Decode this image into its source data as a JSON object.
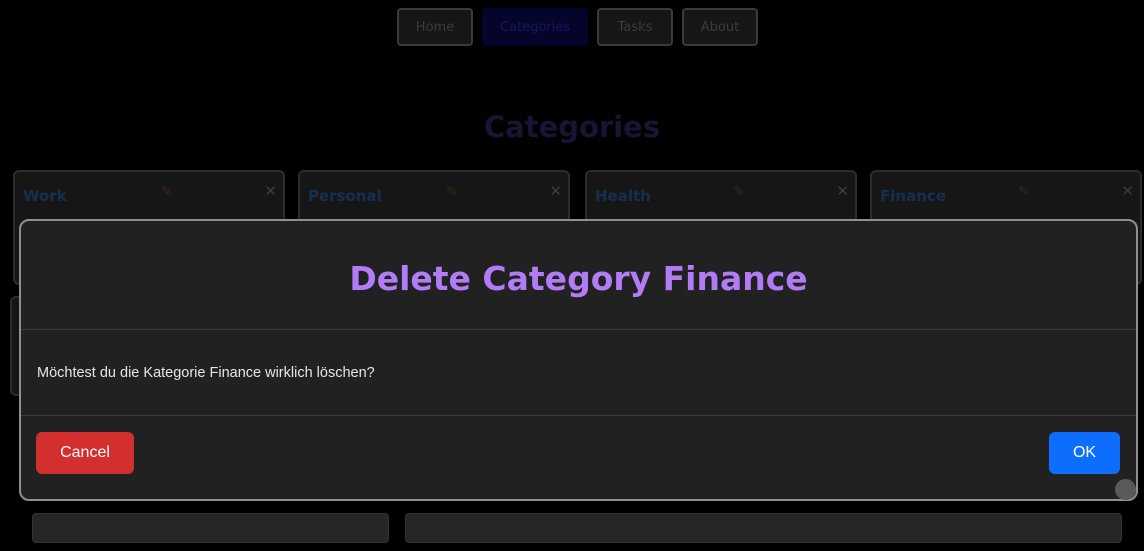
{
  "nav": {
    "tabs": [
      {
        "label": "Home"
      },
      {
        "label": "Categories",
        "active": true
      },
      {
        "label": "Tasks"
      },
      {
        "label": "About"
      }
    ]
  },
  "page": {
    "title": "Categories"
  },
  "categories": [
    {
      "name": "Work",
      "edit_icon": "pencil-icon",
      "close_icon": "close-icon"
    },
    {
      "name": "Personal",
      "edit_icon": "pencil-icon",
      "close_icon": "close-icon"
    },
    {
      "name": "Health",
      "edit_icon": "pencil-icon",
      "close_icon": "close-icon"
    },
    {
      "name": "Finance",
      "edit_icon": "pencil-icon",
      "close_icon": "close-icon"
    }
  ],
  "dialog": {
    "title": "Delete Category Finance",
    "message": "Möchtest du die Kategorie Finance wirklich löschen?",
    "cancel_label": "Cancel",
    "ok_label": "OK"
  },
  "colors": {
    "title": "#b27cf6",
    "cancel": "#d32f2f",
    "ok": "#0d6efd",
    "modal_bg": "#212121"
  }
}
